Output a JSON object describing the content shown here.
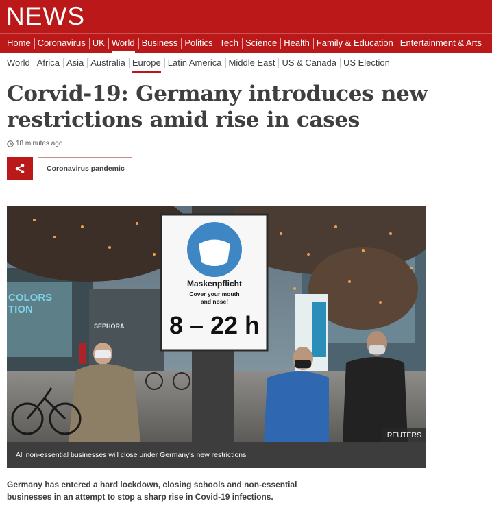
{
  "header": {
    "logo": "NEWS",
    "nav": [
      "Home",
      "Coronavirus",
      "UK",
      "World",
      "Business",
      "Politics",
      "Tech",
      "Science",
      "Health",
      "Family & Education",
      "Entertainment & Arts"
    ],
    "active_nav": "World",
    "subnav": [
      "World",
      "Africa",
      "Asia",
      "Australia",
      "Europe",
      "Latin America",
      "Middle East",
      "US & Canada",
      "US Election"
    ],
    "active_subnav": "Europe"
  },
  "article": {
    "headline": "Corvid-19: Germany introduces new restrictions amid rise in cases",
    "timestamp": "18 minutes ago",
    "tag": "Coronavirus pandemic",
    "image": {
      "sign_title": "Maskenpflicht",
      "sign_sub1": "Cover your mouth",
      "sign_sub2": "and nose!",
      "sign_hours": "8 – 22 h",
      "store_sign_1": "COLORS",
      "store_sign_2": "TION",
      "store_sign_3": "SEPHORA",
      "credit": "REUTERS",
      "caption": "All non-essential businesses will close under Germany's new restrictions"
    },
    "intro": "Germany has entered a hard lockdown, closing schools and non-essential businesses in an attempt to stop a sharp rise in Covid-19 infections."
  },
  "colors": {
    "brand": "#bb1919",
    "text": "#3f3f42"
  },
  "icons": {
    "share": "share-icon",
    "clock": "clock-icon"
  }
}
